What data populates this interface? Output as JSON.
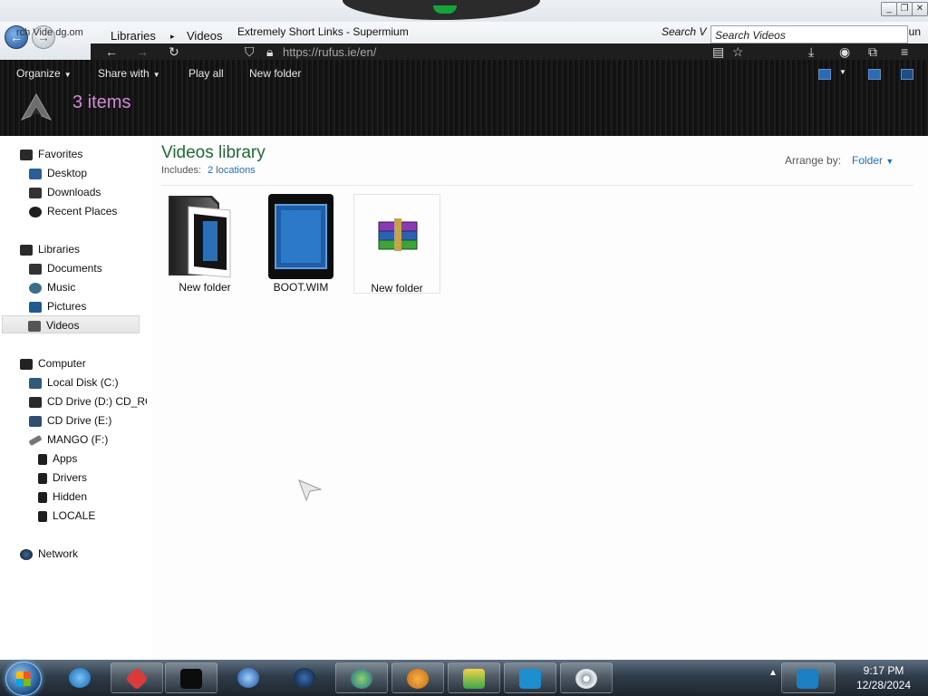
{
  "browser": {
    "tab_label": "Extremely Short Links - Supermium",
    "tab_prefix": "rch Vide dg.om",
    "url": "https://rufus.ie/en/",
    "search_label": "Search V",
    "search_right": "iun"
  },
  "explorer": {
    "breadcrumb": [
      "Libraries",
      "Videos"
    ],
    "search_placeholder": "Search Videos",
    "toolbar": {
      "organize": "Organize",
      "share_with": "Share with",
      "play_all": "Play all",
      "new_folder": "New folder"
    },
    "header_count": "3 items",
    "library_title": "Videos library",
    "includes_label": "Includes:",
    "includes_link": "2 locations",
    "arrange_label": "Arrange by:",
    "arrange_value": "Folder",
    "files": [
      {
        "name": "New folder",
        "icon": "dark-folder-icon"
      },
      {
        "name": "BOOT.WIM",
        "icon": "wim-file-icon"
      },
      {
        "name": "New folder",
        "icon": "winrar-archive-icon"
      }
    ],
    "nav": {
      "favorites": "Favorites",
      "desktop": "Desktop",
      "downloads": "Downloads",
      "recent_places": "Recent Places",
      "libraries": "Libraries",
      "documents": "Documents",
      "music": "Music",
      "pictures": "Pictures",
      "videos": "Videos",
      "computer": "Computer",
      "local_disk": "Local Disk (C:)",
      "cd_drive_d": "CD Drive (D:) CD_RC",
      "cd_drive_e": "CD Drive (E:)",
      "mango": "MANGO (F:)",
      "apps": "Apps",
      "drivers": "Drivers",
      "hidden": "Hidden",
      "locale": "LOCALE",
      "network": "Network"
    }
  },
  "taskbar": {
    "time": "9:17 PM",
    "date": "12/28/2024"
  },
  "colors": {
    "library_title": "#1e6b34",
    "link": "#1d6ec0",
    "items_count": "#d18bd6",
    "header_bg": "#161616"
  }
}
